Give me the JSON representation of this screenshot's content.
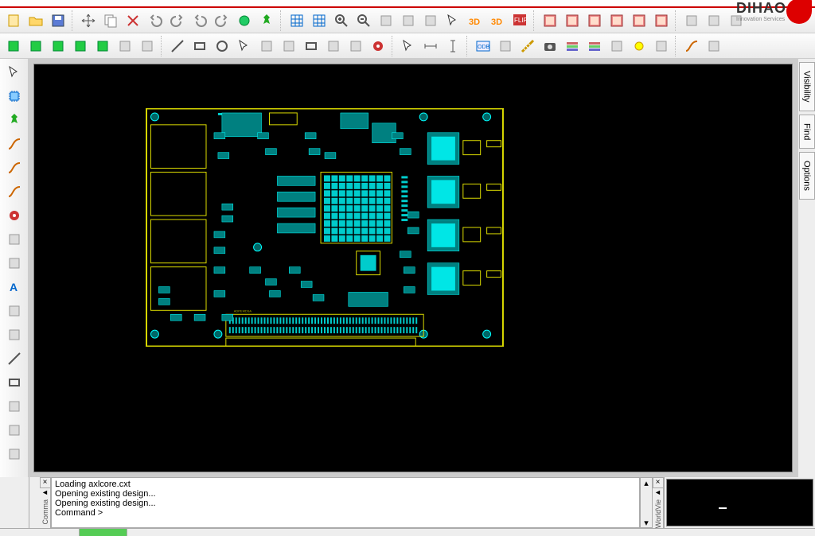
{
  "brand": {
    "name": "DIHAO",
    "tagline": "Innovation Services"
  },
  "toolbar_row1": [
    {
      "name": "new-icon",
      "sep": false
    },
    {
      "name": "open-icon"
    },
    {
      "name": "save-icon"
    },
    {
      "sep": true
    },
    {
      "name": "move-icon"
    },
    {
      "name": "copy-icon"
    },
    {
      "name": "delete-icon"
    },
    {
      "name": "undo-icon"
    },
    {
      "name": "redo-icon"
    },
    {
      "name": "undo2-icon"
    },
    {
      "name": "redo2-icon"
    },
    {
      "name": "refresh-icon"
    },
    {
      "name": "pin-icon"
    },
    {
      "sep": true
    },
    {
      "name": "grid-dot-icon"
    },
    {
      "name": "grid-icon"
    },
    {
      "name": "zoom-in-icon"
    },
    {
      "name": "zoom-out-icon"
    },
    {
      "name": "zoom-fit-icon"
    },
    {
      "name": "zoom-window-icon"
    },
    {
      "name": "zoom-prev-icon"
    },
    {
      "name": "zoom-select-icon"
    },
    {
      "name": "view3d-orbit-icon"
    },
    {
      "name": "view3d-icon"
    },
    {
      "name": "flip-icon"
    },
    {
      "sep": true
    },
    {
      "name": "layer1-icon"
    },
    {
      "name": "layer2-icon"
    },
    {
      "name": "layer3-icon"
    },
    {
      "name": "layer4-icon"
    },
    {
      "name": "layer5-icon"
    },
    {
      "name": "layer6-icon"
    },
    {
      "sep": true
    },
    {
      "name": "drc-icon"
    },
    {
      "name": "report-icon"
    },
    {
      "name": "export-icon"
    }
  ],
  "toolbar_row2": [
    {
      "name": "place-a-icon",
      "g": true
    },
    {
      "name": "place-b-icon",
      "g": true
    },
    {
      "name": "place-c-icon",
      "g": true
    },
    {
      "name": "place-d-icon",
      "g": true
    },
    {
      "name": "place-e-icon",
      "g": true
    },
    {
      "name": "place-f-icon"
    },
    {
      "name": "place-g-icon"
    },
    {
      "sep": true
    },
    {
      "name": "shape-line-icon"
    },
    {
      "name": "shape-rect-icon"
    },
    {
      "name": "shape-circle-icon"
    },
    {
      "name": "shape-select-icon"
    },
    {
      "name": "shape-poly-icon"
    },
    {
      "name": "shape-fillet-icon"
    },
    {
      "name": "shape-rect2-icon"
    },
    {
      "name": "shape-ellipse-icon"
    },
    {
      "name": "shape-arc-icon"
    },
    {
      "name": "shape-via-icon"
    },
    {
      "sep": true
    },
    {
      "name": "select-comp-icon"
    },
    {
      "name": "dim-h-icon"
    },
    {
      "name": "dim-v-icon"
    },
    {
      "sep": true
    },
    {
      "name": "odbpp-icon"
    },
    {
      "name": "doc-icon"
    },
    {
      "name": "measure-icon"
    },
    {
      "name": "snapshot-icon"
    },
    {
      "name": "xsection-icon"
    },
    {
      "name": "xsection2-icon"
    },
    {
      "name": "assign-icon"
    },
    {
      "name": "highlight-icon"
    },
    {
      "name": "dedupe-icon"
    },
    {
      "sep": true
    },
    {
      "name": "route-icon"
    },
    {
      "name": "carve-icon"
    }
  ],
  "left_toolbar": [
    {
      "name": "select-tool-icon",
      "g": true
    },
    {
      "name": "chip-tool-icon"
    },
    {
      "name": "pin-tool-icon"
    },
    {
      "name": "route-line-icon"
    },
    {
      "name": "route-angle-icon"
    },
    {
      "name": "route-bus-icon"
    },
    {
      "name": "via-tool-icon"
    },
    {
      "name": "slide-icon"
    },
    {
      "name": "fanout-icon"
    },
    {
      "name": "text-tool-icon"
    },
    {
      "name": "cluster-icon"
    },
    {
      "name": "swap-icon"
    },
    {
      "name": "line-tool-icon"
    },
    {
      "name": "rect-tool-icon"
    },
    {
      "name": "label-tool-icon"
    },
    {
      "name": "brush-tool-icon"
    },
    {
      "name": "plane-tool-icon"
    }
  ],
  "right_tabs": [
    "Visibility",
    "Find",
    "Options"
  ],
  "console": {
    "lines": [
      "Loading axlcore.cxt",
      "Opening existing design...",
      "Opening existing design...",
      "Command >"
    ]
  },
  "gutters": {
    "command": "Comma",
    "world": "WorldVie"
  }
}
